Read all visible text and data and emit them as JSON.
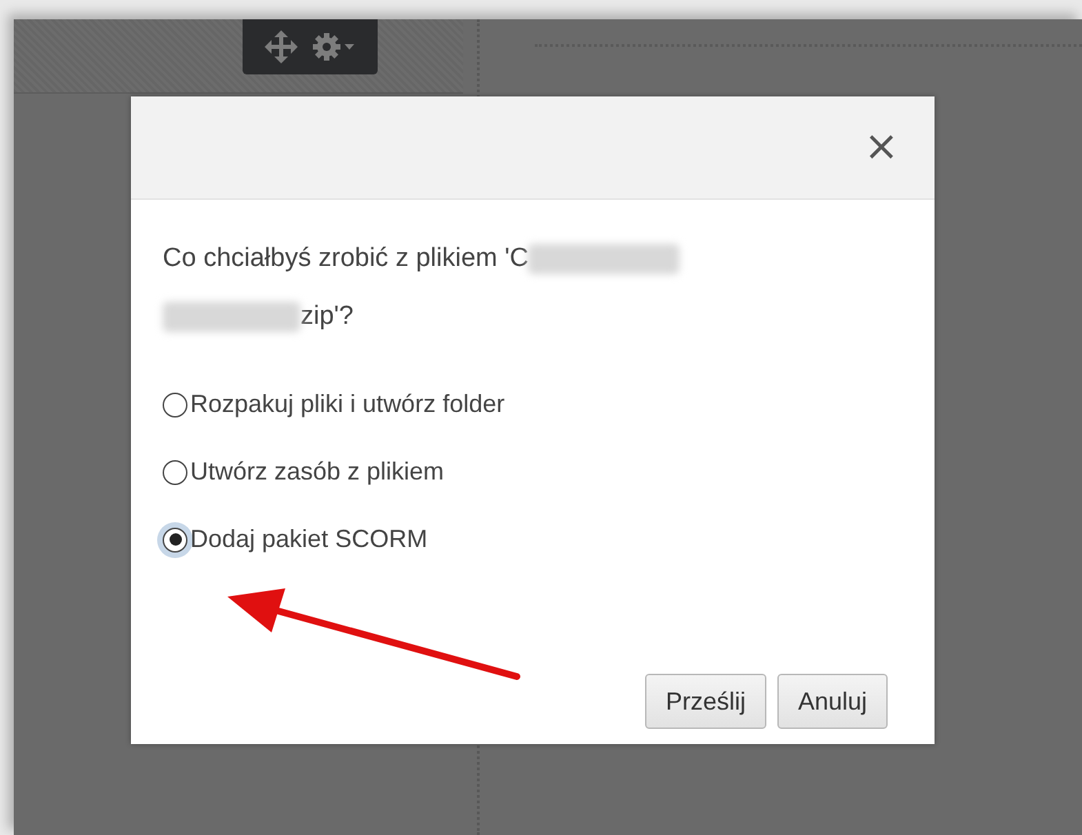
{
  "dialog": {
    "close_label": "×",
    "question_start": "Co chciałbyś zrobić z plikiem 'C",
    "question_end": "zip'?",
    "options": [
      {
        "label": "Rozpakuj pliki i utwórz folder",
        "selected": false
      },
      {
        "label": "Utwórz zasób z plikiem",
        "selected": false
      },
      {
        "label": "Dodaj pakiet SCORM",
        "selected": true
      }
    ],
    "buttons": [
      "Prześlij",
      "Anuluj"
    ]
  }
}
